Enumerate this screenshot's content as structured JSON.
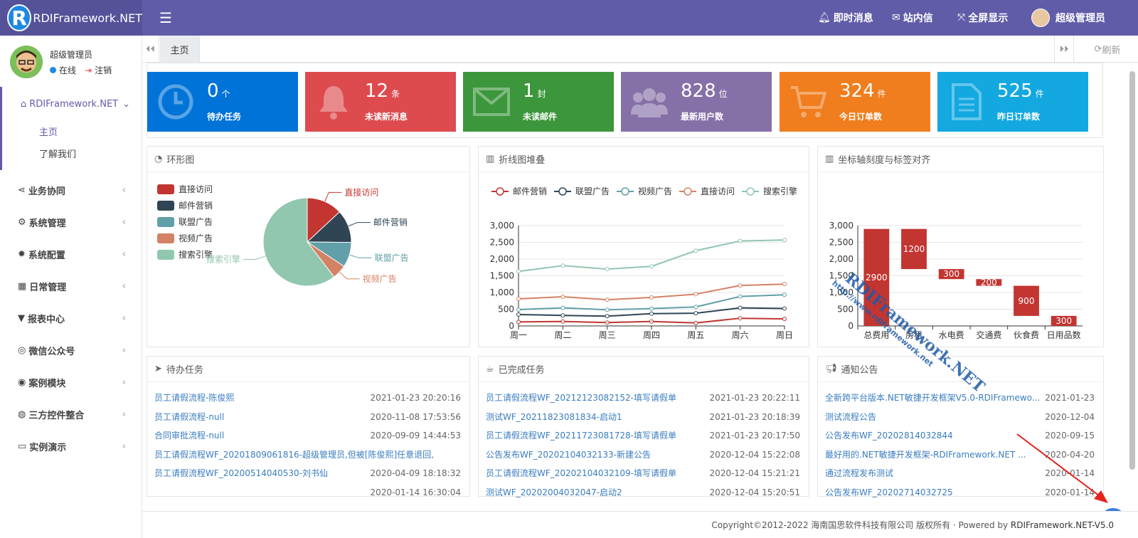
{
  "app": {
    "title": "RDIFramework.NET",
    "logo_letter": "R"
  },
  "topnav": {
    "menu_icon": "menu-icon",
    "messages": "即时消息",
    "mail": "站内信",
    "fullscreen": "全屏显示",
    "user": "超级管理员"
  },
  "user": {
    "name": "超级管理员",
    "status": "在线",
    "logout": "注销"
  },
  "sidebar": {
    "home_group": "RDIFramework.NET",
    "home_items": [
      "主页",
      "了解我们"
    ],
    "items": [
      {
        "label": "业务协同",
        "icon": "share-icon"
      },
      {
        "label": "系统管理",
        "icon": "cogs-icon"
      },
      {
        "label": "系统配置",
        "icon": "gear-icon"
      },
      {
        "label": "日常管理",
        "icon": "calendar-icon"
      },
      {
        "label": "报表中心",
        "icon": "filter-icon"
      },
      {
        "label": "微信公众号",
        "icon": "wechat-icon"
      },
      {
        "label": "案例模块",
        "icon": "eye-icon"
      },
      {
        "label": "三方控件整合",
        "icon": "globe-icon"
      },
      {
        "label": "实例演示",
        "icon": "desktop-icon"
      }
    ]
  },
  "tabs": {
    "home": "主页",
    "refresh": "刷新"
  },
  "stats": [
    {
      "value": "0",
      "unit": "个",
      "label": "待办任务",
      "color": "#0073d8",
      "icon": "clock-icon"
    },
    {
      "value": "12",
      "unit": "条",
      "label": "未读新消息",
      "color": "#dd4b4f",
      "icon": "bell-icon"
    },
    {
      "value": "1",
      "unit": "封",
      "label": "未读邮件",
      "color": "#3c963c",
      "icon": "envelope-icon"
    },
    {
      "value": "828",
      "unit": "位",
      "label": "最新用户数",
      "color": "#8670a8",
      "icon": "users-icon"
    },
    {
      "value": "324",
      "unit": "件",
      "label": "今日订单数",
      "color": "#f07d1e",
      "icon": "cart-icon"
    },
    {
      "value": "525",
      "unit": "件",
      "label": "昨日订单数",
      "color": "#13a8e0",
      "icon": "file-icon"
    }
  ],
  "panels": {
    "pie": "环形图",
    "line": "折线图堆叠",
    "bar": "坐标轴刻度与标签对齐",
    "todo": "待办任务",
    "done": "已完成任务",
    "notice": "通知公告"
  },
  "chart_data": [
    {
      "type": "pie",
      "title": "",
      "categories": [
        "直接访问",
        "邮件营销",
        "联盟广告",
        "视频广告",
        "搜索引擎"
      ],
      "values": [
        335,
        310,
        234,
        135,
        1548
      ],
      "colors": [
        "#c23531",
        "#2f4554",
        "#61a0a8",
        "#d48265",
        "#91c7ae"
      ]
    },
    {
      "type": "line",
      "title": "",
      "categories": [
        "周一",
        "周二",
        "周三",
        "周四",
        "周五",
        "周六",
        "周日"
      ],
      "ylim": [
        0,
        3000
      ],
      "yticks": [
        "0",
        "500",
        "1,000",
        "1,500",
        "2,000",
        "2,500",
        "3,000"
      ],
      "series": [
        {
          "name": "邮件营销",
          "values": [
            120,
            132,
            101,
            134,
            90,
            230,
            210
          ],
          "color": "#c23531"
        },
        {
          "name": "联盟广告",
          "values": [
            340,
            314,
            292,
            368,
            380,
            540,
            520
          ],
          "color": "#2f4554"
        },
        {
          "name": "视频广告",
          "values": [
            490,
            540,
            483,
            518,
            570,
            880,
            930
          ],
          "color": "#61a0a8"
        },
        {
          "name": "直接访问",
          "values": [
            810,
            872,
            784,
            850,
            950,
            1210,
            1250
          ],
          "color": "#d48265"
        },
        {
          "name": "搜索引擎",
          "values": [
            1630,
            1803,
            1700,
            1782,
            2250,
            2540,
            2570
          ],
          "color": "#91c7ae"
        }
      ]
    },
    {
      "type": "bar",
      "title": "",
      "categories": [
        "总费用",
        "房租",
        "水电费",
        "交通费",
        "伙食费",
        "日用品数"
      ],
      "ylim": [
        0,
        3000
      ],
      "yticks": [
        "0",
        "500",
        "1,000",
        "1,500",
        "2,000",
        "2,500",
        "3,000"
      ],
      "base": [
        0,
        1700,
        1400,
        1200,
        300,
        0
      ],
      "values": [
        2900,
        1200,
        300,
        200,
        900,
        300
      ],
      "color": "#c23531"
    }
  ],
  "todo": [
    {
      "title": "员工请假流程-陈俊熙",
      "date": "2021-01-23 20:20:16"
    },
    {
      "title": "员工请假流程-null",
      "date": "2020-11-08 17:53:56"
    },
    {
      "title": "合同审批流程-null",
      "date": "2020-09-09 14:44:53"
    },
    {
      "title": "员工请假流程WF_20201809061816-超级管理员,但被[陈俊熙]任意退回,",
      "date": ""
    },
    {
      "title": "员工请假流程WF_20200514040530-刘书仙",
      "date": "2020-04-09 18:18:32"
    },
    {
      "title": "",
      "date": "2020-01-14 16:30:04"
    }
  ],
  "done": [
    {
      "title": "员工请假流程WF_20212123082152-填写请假单",
      "date": "2021-01-23 20:22:11"
    },
    {
      "title": "测试WF_20211823081834-启动1",
      "date": "2021-01-23 20:18:39"
    },
    {
      "title": "员工请假流程WF_20211723081728-填写请假单",
      "date": "2021-01-23 20:17:50"
    },
    {
      "title": "公告发布WF_20202104032133-新建公告",
      "date": "2020-12-04 15:22:08"
    },
    {
      "title": "员工请假流程WF_20202104032109-填写请假单",
      "date": "2020-12-04 15:21:21"
    },
    {
      "title": "测试WF_20202004032047-启动2",
      "date": "2020-12-04 15:20:51"
    }
  ],
  "notice": [
    {
      "title": "全新跨平台版本.NET敏捷开发框架V5.0-RDIFramewo...",
      "date": "2021-01-23"
    },
    {
      "title": "测试流程公告",
      "date": "2020-12-04"
    },
    {
      "title": "公告发布WF_20202814032844",
      "date": "2020-09-15"
    },
    {
      "title": "最好用的.NET敏捷开发框架-RDIFramework.NET ...",
      "date": "2020-04-20"
    },
    {
      "title": "通过流程发布测试",
      "date": "2020-01-14"
    },
    {
      "title": "公告发布WF_20202714032725",
      "date": "2020-01-14"
    }
  ],
  "watermark": "RDIFramework.NET http://www.rdiframework.net",
  "footer": {
    "copyright": "Copyright©2012-2022 海南国思软件科技有限公司 版权所有 · Powered by",
    "powered": "RDIFramework.NET-V5.0"
  }
}
